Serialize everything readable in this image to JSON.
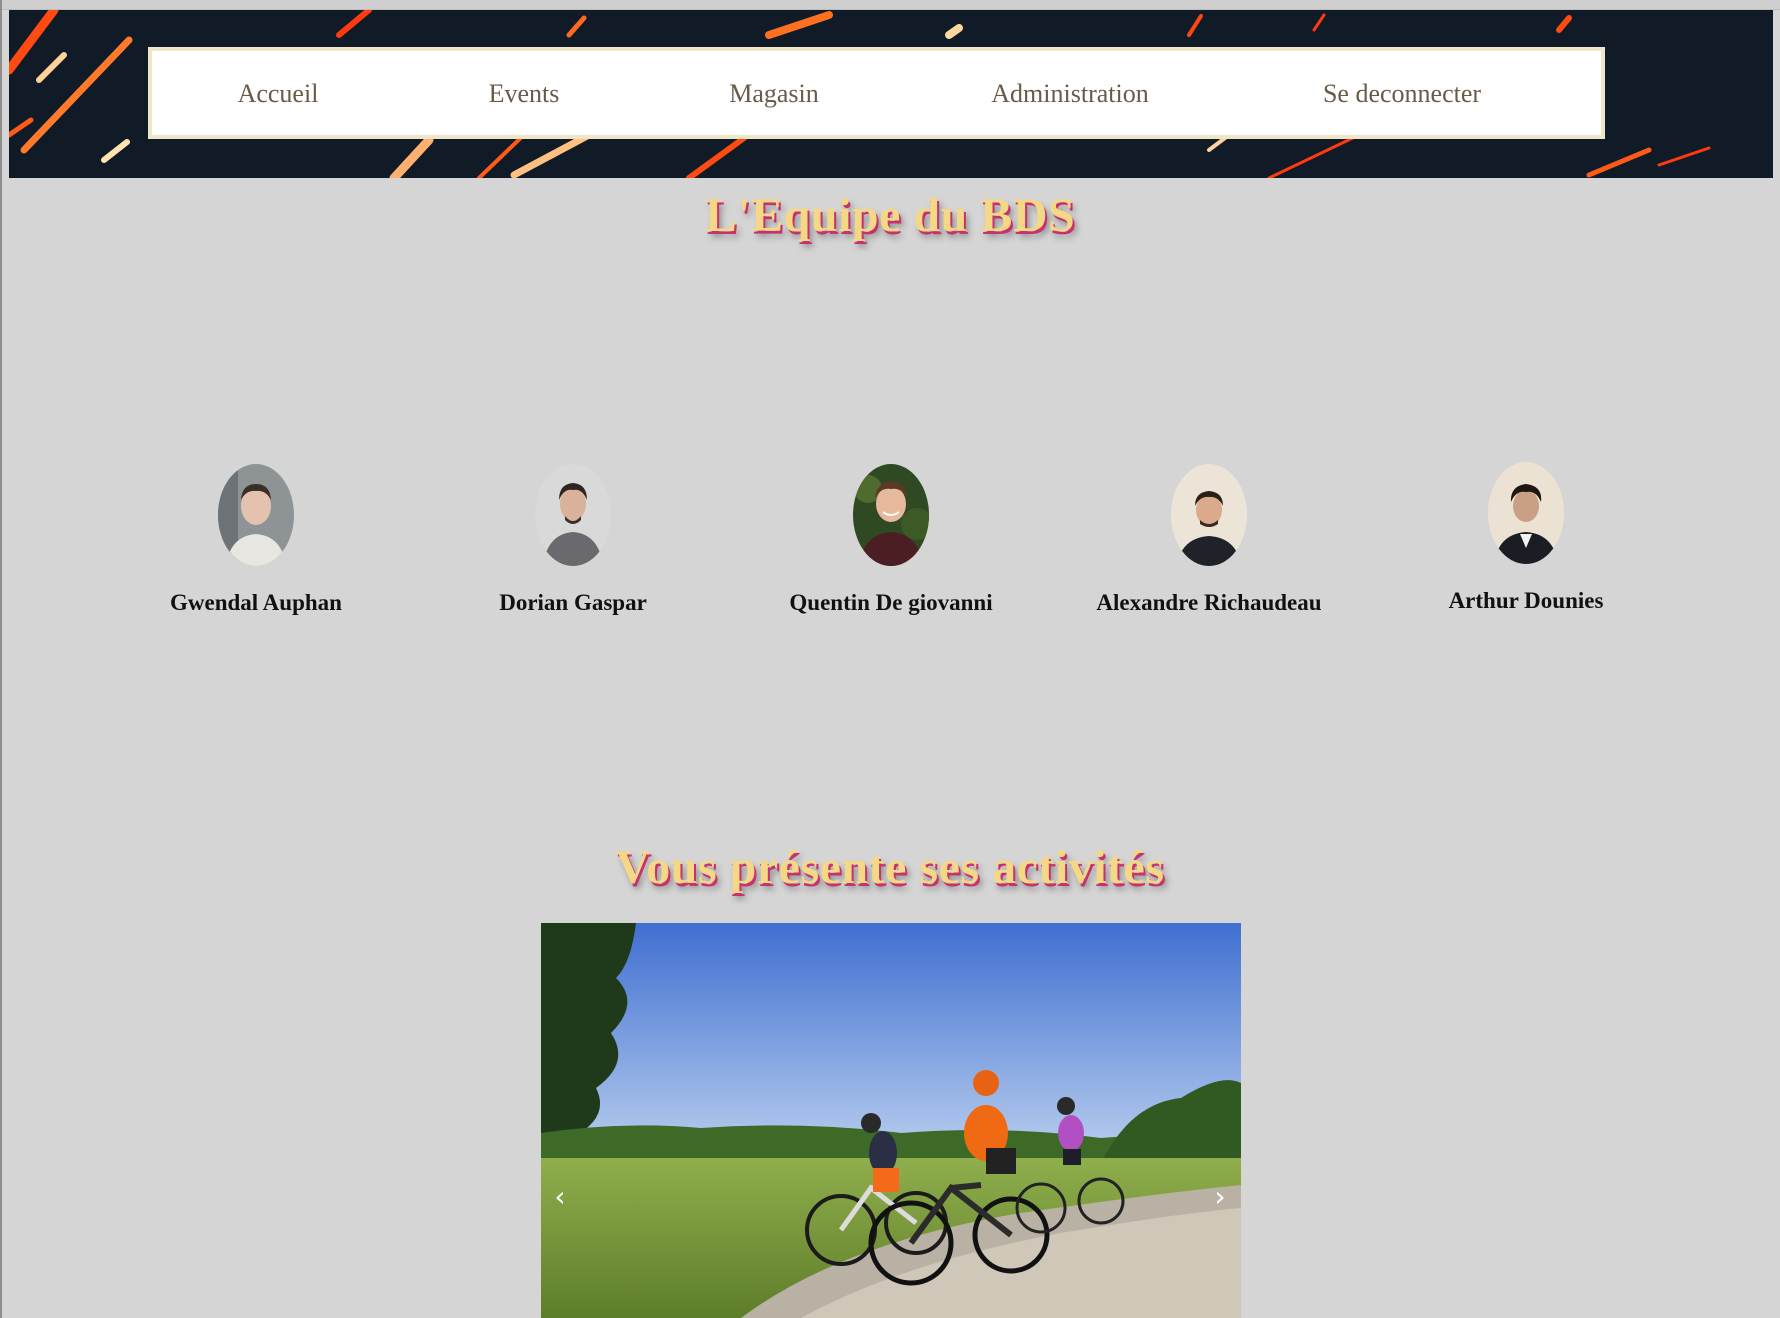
{
  "nav": {
    "items": [
      {
        "label": "Accueil"
      },
      {
        "label": "Events"
      },
      {
        "label": "Magasin"
      },
      {
        "label": "Administration"
      },
      {
        "label": "Se deconnecter"
      }
    ]
  },
  "team": {
    "title": "L'Equipe du BDS",
    "members": [
      {
        "name": "Gwendal Auphan"
      },
      {
        "name": "Dorian Gaspar"
      },
      {
        "name": "Quentin De giovanni"
      },
      {
        "name": "Alexandre Richaudeau"
      },
      {
        "name": "Arthur Dounies"
      }
    ]
  },
  "activities": {
    "title": "Vous présente ses activités",
    "carousel": {
      "prev_icon": "‹",
      "next_icon": "›"
    }
  },
  "colors": {
    "page_background": "#d5d5d5",
    "banner_background": "#101b27",
    "nav_text": "#6a5a48",
    "heading_fill": "#f5d885",
    "heading_shadow": "#c8306f"
  }
}
